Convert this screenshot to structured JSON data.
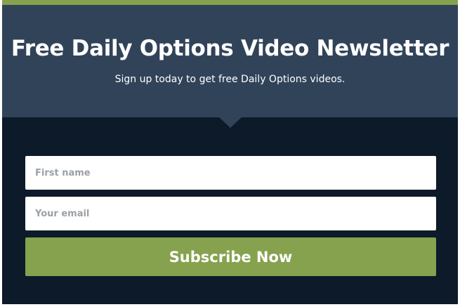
{
  "header": {
    "title": "Free Daily Options Video Newsletter",
    "subtitle": "Sign up today to get free Daily Options videos."
  },
  "form": {
    "first_name": {
      "value": "",
      "placeholder": "First name"
    },
    "email": {
      "value": "",
      "placeholder": "Your email"
    },
    "subscribe_label": "Subscribe Now"
  },
  "colors": {
    "accent_green": "#86a24e",
    "header_bg": "#314359",
    "form_bg": "#0d1a29"
  }
}
